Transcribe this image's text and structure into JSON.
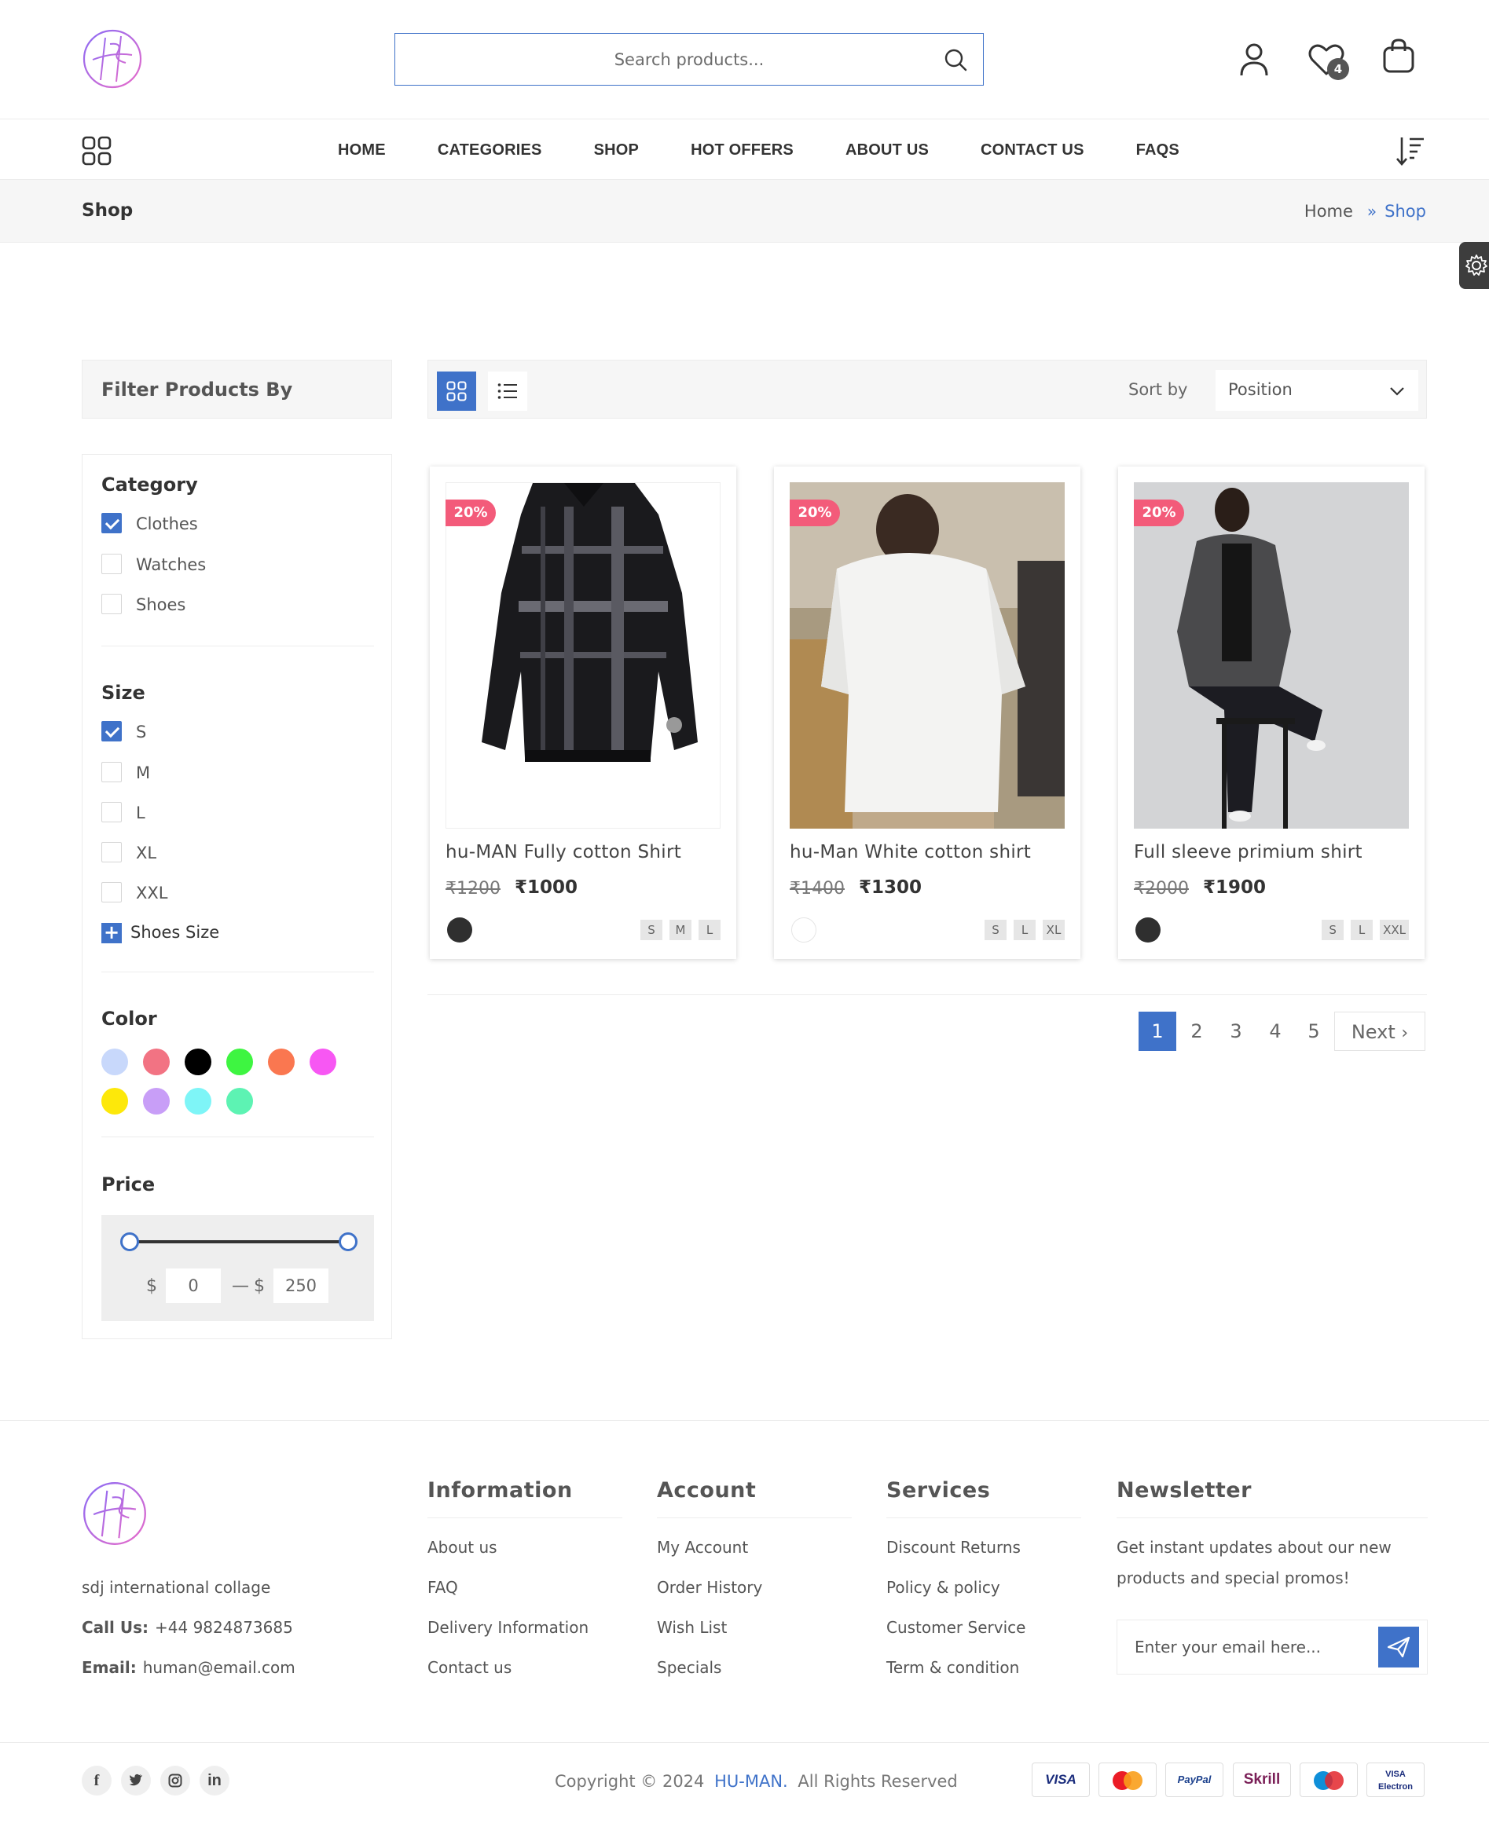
{
  "header": {
    "search_placeholder": "Search products...",
    "wishlist_count": "4"
  },
  "nav": {
    "items": [
      "HOME",
      "CATEGORIES",
      "SHOP",
      "HOT OFFERS",
      "ABOUT US",
      "CONTACT US",
      "FAQS"
    ]
  },
  "breadcrumb": {
    "title": "Shop",
    "home": "Home",
    "current": "Shop"
  },
  "sidebar": {
    "heading": "Filter Products By",
    "category": {
      "title": "Category",
      "items": [
        {
          "label": "Clothes",
          "checked": true
        },
        {
          "label": "Watches",
          "checked": false
        },
        {
          "label": "Shoes",
          "checked": false
        }
      ]
    },
    "size": {
      "title": "Size",
      "items": [
        {
          "label": "S",
          "checked": true
        },
        {
          "label": "M",
          "checked": false
        },
        {
          "label": "L",
          "checked": false
        },
        {
          "label": "XL",
          "checked": false
        },
        {
          "label": "XXL",
          "checked": false
        }
      ],
      "shoes_size_label": "Shoes Size"
    },
    "color": {
      "title": "Color",
      "swatches": [
        "#c8d8fb",
        "#f27383",
        "#000000",
        "#3ef541",
        "#fa7750",
        "#f757f3",
        "#fde80a",
        "#c89ef7",
        "#7ef5f7",
        "#5df3b3"
      ]
    },
    "price": {
      "title": "Price",
      "currency": "$",
      "min": "0",
      "max": "250",
      "separator": "—"
    }
  },
  "toolbar": {
    "sort_label": "Sort by",
    "sort_value": "Position"
  },
  "products": [
    {
      "name": "hu-MAN Fully cotton Shirt",
      "old_price": "₹1200",
      "price": "₹1000",
      "discount": "20%",
      "color": "#2f2f2f",
      "sizes": [
        "S",
        "M",
        "L"
      ]
    },
    {
      "name": "hu-Man White cotton shirt",
      "old_price": "₹1400",
      "price": "₹1300",
      "discount": "20%",
      "color": "#ffffff",
      "sizes": [
        "S",
        "L",
        "XL"
      ]
    },
    {
      "name": "Full sleeve primium shirt",
      "old_price": "₹2000",
      "price": "₹1900",
      "discount": "20%",
      "color": "#2f2f2f",
      "sizes": [
        "S",
        "L",
        "XXL"
      ]
    }
  ],
  "pagination": {
    "pages": [
      "1",
      "2",
      "3",
      "4",
      "5"
    ],
    "current": "1",
    "next": "Next"
  },
  "footer": {
    "address": "sdj international collage",
    "call_label": "Call Us:",
    "call_value": "+44 9824873685",
    "email_label": "Email:",
    "email_value": "human@email.com",
    "columns": [
      {
        "title": "Information",
        "links": [
          "About us",
          "FAQ",
          "Delivery Information",
          "Contact us"
        ]
      },
      {
        "title": "Account",
        "links": [
          "My Account",
          "Order History",
          "Wish List",
          "Specials"
        ]
      },
      {
        "title": "Services",
        "links": [
          "Discount Returns",
          "Policy & policy",
          "Customer Service",
          "Term & condition"
        ]
      }
    ],
    "newsletter": {
      "title": "Newsletter",
      "line1": "Get instant updates about our new",
      "line2": "products and special promos!",
      "placeholder": "Enter your email here..."
    },
    "social": [
      "f",
      "t",
      "ig",
      "in"
    ],
    "copyright_prefix": "Copyright © 2024",
    "brand": "HU-MAN.",
    "copyright_suffix": "All Rights Reserved",
    "payments": [
      "VISA",
      "MasterCard",
      "PayPal",
      "Skrill",
      "Maestro",
      "VISA Electron"
    ]
  }
}
